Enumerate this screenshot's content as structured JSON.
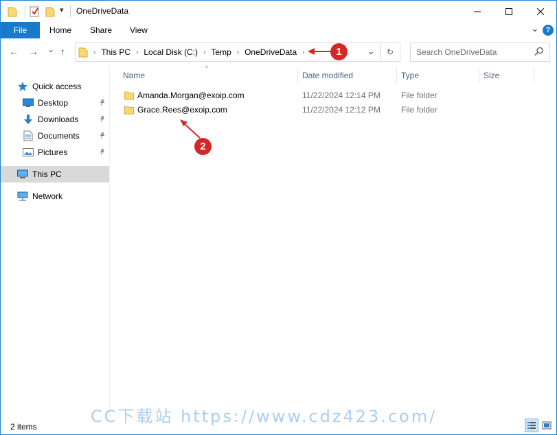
{
  "window": {
    "title": "OneDriveData",
    "controls": {
      "minimize": "—",
      "maximize": "☐",
      "close": "✕"
    }
  },
  "quick_access_toolbar": {
    "dropdown": "▾"
  },
  "ribbon": {
    "tabs": [
      "File",
      "Home",
      "Share",
      "View"
    ],
    "collapse": "⌄",
    "help": "?"
  },
  "nav": {
    "back": "←",
    "forward": "→",
    "recent": "⌄",
    "up": "↑",
    "breadcrumb": [
      "This PC",
      "Local Disk (C:)",
      "Temp",
      "OneDriveData"
    ],
    "separator": "›",
    "address_dropdown": "⌄",
    "refresh": "↻",
    "search_placeholder": "Search OneDriveData"
  },
  "sidebar": {
    "quick_access": "Quick access",
    "items": [
      {
        "label": "Desktop",
        "icon": "desktop-icon",
        "pinned": true
      },
      {
        "label": "Downloads",
        "icon": "download-icon",
        "pinned": true
      },
      {
        "label": "Documents",
        "icon": "documents-icon",
        "pinned": true
      },
      {
        "label": "Pictures",
        "icon": "pictures-icon",
        "pinned": true
      }
    ],
    "this_pc": "This PC",
    "network": "Network",
    "pin_glyph": "📌"
  },
  "columns": {
    "name": "Name",
    "date": "Date modified",
    "type": "Type",
    "size": "Size",
    "sort_indicator": "^"
  },
  "files": [
    {
      "name": "Amanda.Morgan@exoip.com",
      "date": "11/22/2024 12:14 PM",
      "type": "File folder",
      "size": ""
    },
    {
      "name": "Grace.Rees@exoip.com",
      "date": "11/22/2024 12:12 PM",
      "type": "File folder",
      "size": ""
    }
  ],
  "annotations": {
    "one": "1",
    "two": "2",
    "color": "#d62727"
  },
  "status": {
    "items": "2 items"
  },
  "watermark": "CC下载站 https://www.cdz423.com/",
  "colors": {
    "accent": "#1979ca",
    "selection": "#d9d9d9",
    "folder": "#f8d775"
  }
}
